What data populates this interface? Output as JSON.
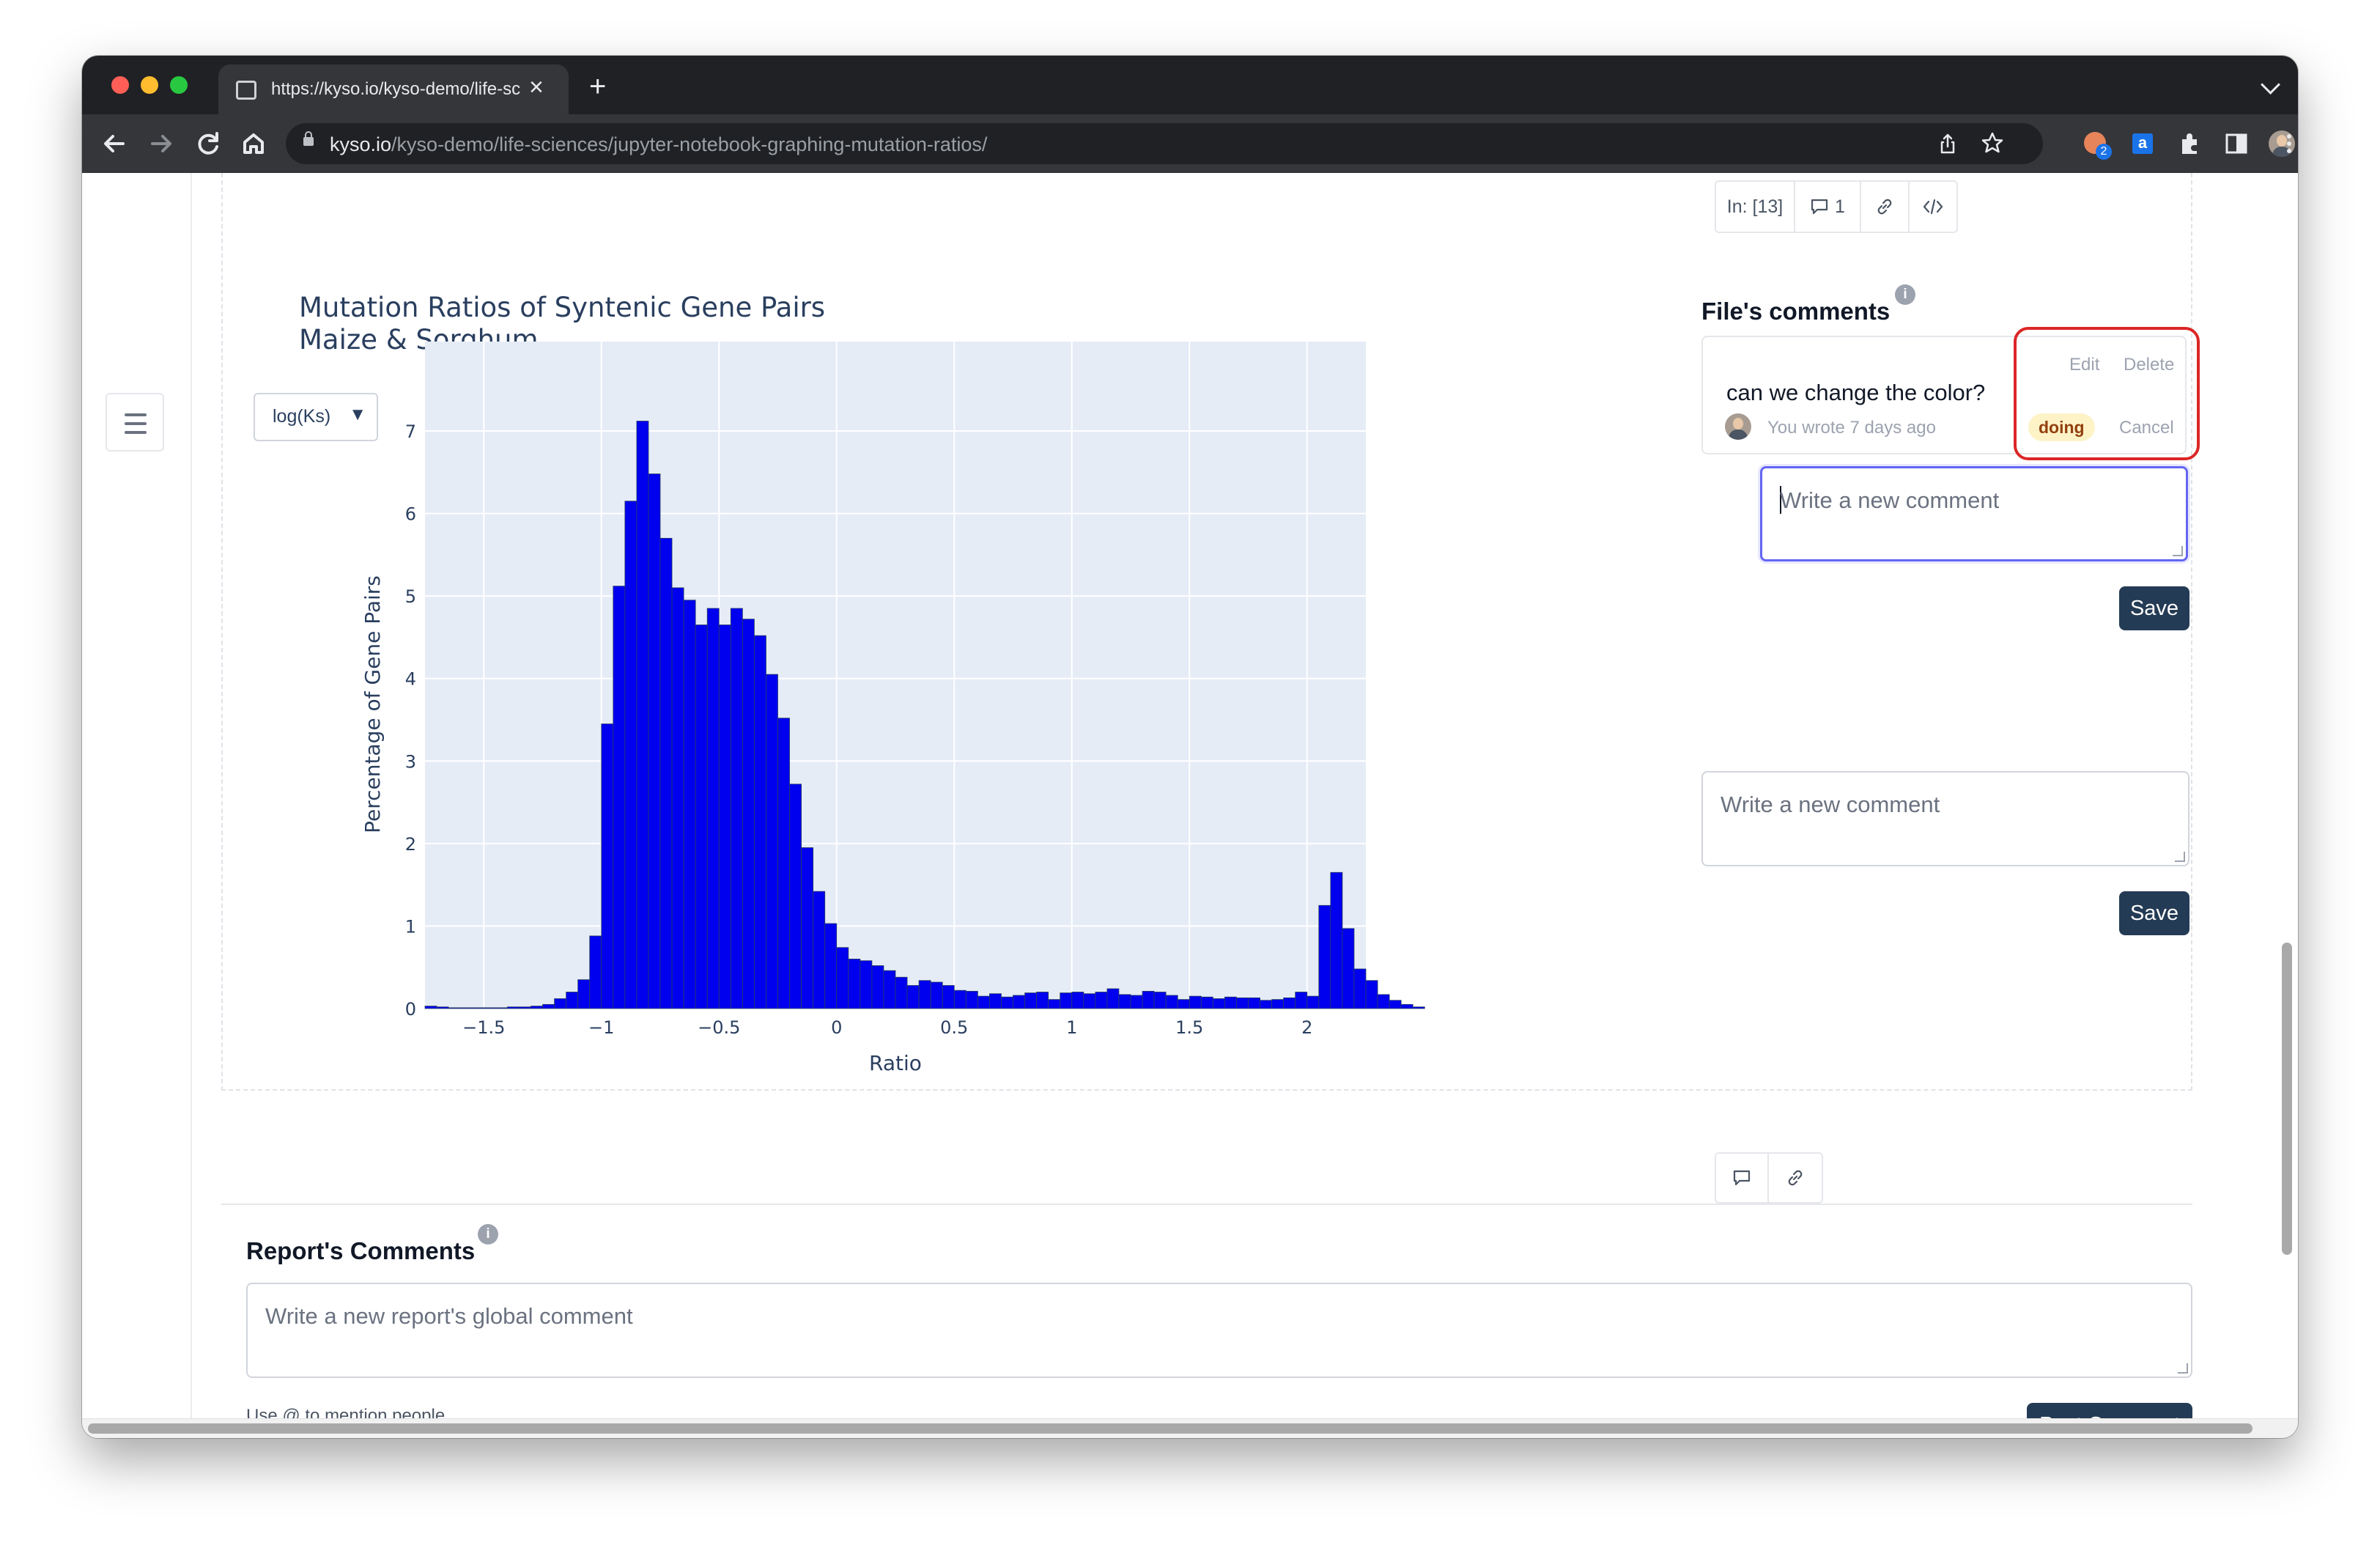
{
  "browser": {
    "tab_title": "https://kyso.io/kyso-demo/life-sciences/jupyter-notebook-graphing-mutation-ratios/",
    "close_glyph": "×",
    "new_tab_glyph": "+",
    "url_host": "kyso.io",
    "url_path": "/kyso-demo/life-sciences/jupyter-notebook-graphing-mutation-ratios/",
    "extension_badge": "2",
    "translate_ext_label": "a",
    "traffic_colors": [
      "#ff5f57",
      "#febc2e",
      "#28c840"
    ]
  },
  "cell_toolbar": {
    "input_label": "In: [13]",
    "comment_count": "1"
  },
  "chart_data": {
    "type": "bar",
    "title_line1": "Mutation Ratios of Syntenic Gene Pairs",
    "title_line2": "Maize & Sorghum",
    "xlabel": "Ratio",
    "ylabel": "Percentage of Gene Pairs",
    "dropdown_selected": "log(Ks)",
    "dropdown_caret": "▼",
    "bar_color": "#0000ee",
    "plot_bg": "#e5ecf6",
    "xlim": [
      -1.75,
      2.25
    ],
    "ylim": [
      0,
      7.2
    ],
    "bin_width": 0.05,
    "bin_start": -1.75,
    "x_ticks": [
      -1.5,
      -1,
      -0.5,
      0,
      0.5,
      1,
      1.5,
      2
    ],
    "x_tick_labels": [
      "−1.5",
      "−1",
      "−0.5",
      "0",
      "0.5",
      "1",
      "1.5",
      "2"
    ],
    "y_ticks": [
      0,
      1,
      2,
      3,
      4,
      5,
      6,
      7
    ],
    "y_tick_labels": [
      "0",
      "1",
      "2",
      "3",
      "4",
      "5",
      "6",
      "7"
    ],
    "values": [
      0.03,
      0.02,
      0.01,
      0.01,
      0.01,
      0.01,
      0.01,
      0.02,
      0.02,
      0.03,
      0.05,
      0.12,
      0.2,
      0.35,
      0.88,
      3.45,
      5.12,
      6.15,
      7.12,
      6.48,
      5.7,
      5.1,
      4.95,
      4.65,
      4.85,
      4.65,
      4.85,
      4.72,
      4.52,
      4.05,
      3.52,
      2.72,
      1.95,
      1.42,
      1.03,
      0.74,
      0.6,
      0.58,
      0.52,
      0.46,
      0.38,
      0.28,
      0.34,
      0.32,
      0.28,
      0.22,
      0.21,
      0.15,
      0.18,
      0.14,
      0.16,
      0.19,
      0.2,
      0.11,
      0.19,
      0.2,
      0.18,
      0.2,
      0.24,
      0.17,
      0.16,
      0.21,
      0.2,
      0.16,
      0.11,
      0.15,
      0.14,
      0.12,
      0.14,
      0.13,
      0.13,
      0.1,
      0.11,
      0.13,
      0.2,
      0.15,
      1.25,
      1.65,
      0.97,
      0.48,
      0.34,
      0.17,
      0.1,
      0.05,
      0.02
    ]
  },
  "files_comments": {
    "title": "File's comments",
    "info_glyph": "i",
    "comment": {
      "text": "can we change the color?",
      "meta": "You wrote 7 days ago",
      "edit_label": "Edit",
      "delete_label": "Delete",
      "status": "doing",
      "cancel_label": "Cancel"
    },
    "reply_placeholder": "Write a new comment",
    "reply_save_label": "Save",
    "new_placeholder": "Write a new comment",
    "new_save_label": "Save"
  },
  "report_comments": {
    "title": "Report's Comments",
    "info_glyph": "i",
    "placeholder": "Write a new report's global comment",
    "mention_hint": "Use @ to mention people",
    "post_label": "Post Comment"
  },
  "sidebar": {
    "menu_icon": "hamburger-menu"
  }
}
